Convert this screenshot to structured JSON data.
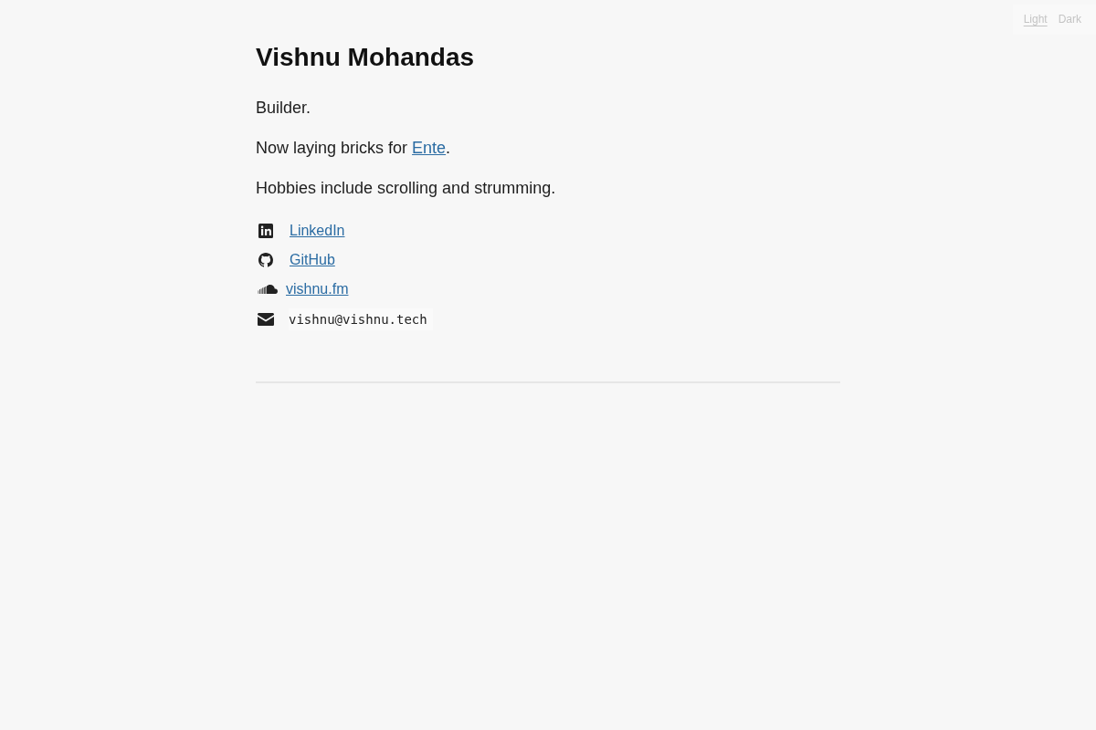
{
  "theme_switcher": {
    "options": [
      {
        "label": "Light",
        "selected": true
      },
      {
        "label": "Dark",
        "selected": false
      }
    ]
  },
  "header": {
    "title": "Vishnu Mohandas"
  },
  "bio": [
    {
      "text": "Builder."
    },
    {
      "text": "Now laying bricks for ",
      "link": "Ente",
      "after": "."
    },
    {
      "text": "Hobbies include scrolling and strumming."
    }
  ],
  "links": [
    {
      "kind": "linkedin",
      "label": "LinkedIn"
    },
    {
      "kind": "github",
      "label": "GitHub"
    },
    {
      "kind": "soundcloud",
      "label": "vishnu.fm"
    },
    {
      "kind": "email",
      "label": "vishnu@vishnu.tech"
    }
  ]
}
